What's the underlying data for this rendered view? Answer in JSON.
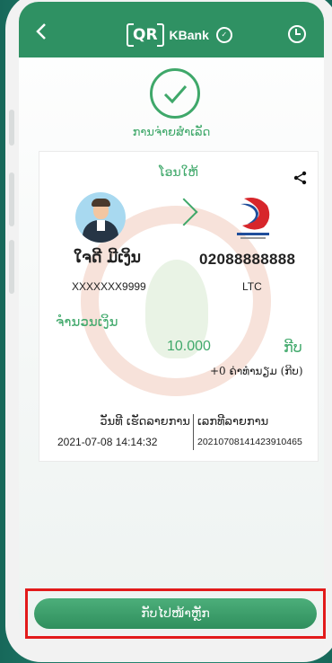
{
  "header": {
    "back_icon": "chevron-left-icon",
    "logo_qr": "QR",
    "logo_brand": "KBank",
    "history_icon": "history-icon"
  },
  "status": {
    "icon": "check-circle-icon",
    "text": "ການຈ່າຍສຳເລັດ"
  },
  "receipt": {
    "title": "ໂອນໃຫ້",
    "share_icon": "share-icon",
    "sender": {
      "avatar_icon": "avatar",
      "name": "ໃຈດີ ມີເງິນ",
      "account": "XXXXXXX9999"
    },
    "recipient": {
      "logo_icon": "ltc-logo",
      "number": "02088888888",
      "name": "LTC"
    },
    "amount": {
      "label": "ຈຳນວນເງິນ",
      "value": "10.000",
      "currency": "ກີບ",
      "fee": "+0 ຄ່າທຳນຽມ (ກີບ)"
    },
    "date": {
      "label": "ວັນທີ ເຮັດລາຍການ",
      "value": "2021-07-08 14:14:32"
    },
    "reference": {
      "label": "ເລກທີລາຍການ",
      "value": "20210708141423910465"
    }
  },
  "actions": {
    "home_label": "ກັບໄປໜ້າຫຼັກ"
  },
  "colors": {
    "header": "#2f9163",
    "accent": "#3fa86a",
    "highlight": "#e21b1b",
    "background": "#1f7a68"
  }
}
